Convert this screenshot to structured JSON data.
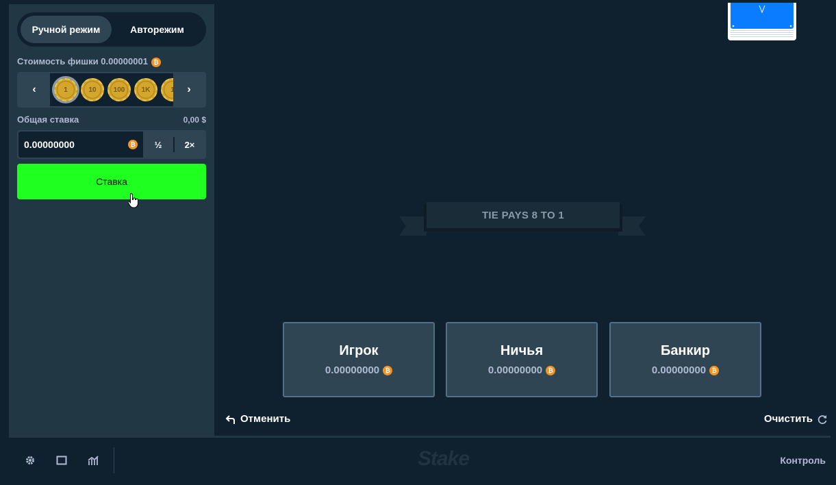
{
  "sidebar": {
    "modes": [
      "Ручной режим",
      "Авторежим"
    ],
    "chip_value_label": "Стоимость фишки 0.00000001",
    "chips": [
      "1",
      "10",
      "100",
      "1K",
      "1"
    ],
    "total_bet_label": "Общая ставка",
    "total_bet_usd": "0,00 $",
    "bet_amount": "0.00000000",
    "half_label": "½",
    "double_label": "2×",
    "bet_button_label": "Ставка"
  },
  "game": {
    "banner": "TIE PAYS 8 TO 1",
    "areas": [
      {
        "title": "Игрок",
        "amount": "0.00000000"
      },
      {
        "title": "Ничья",
        "amount": "0.00000000"
      },
      {
        "title": "Банкир",
        "amount": "0.00000000"
      }
    ],
    "undo_label": "Отменить",
    "clear_label": "Очистить"
  },
  "footer": {
    "logo": "Stake",
    "control_label": "Контроль"
  },
  "colors": {
    "accent_green": "#1fff20",
    "btc_orange": "#f7931a",
    "card_blue": "#0a7cff"
  }
}
